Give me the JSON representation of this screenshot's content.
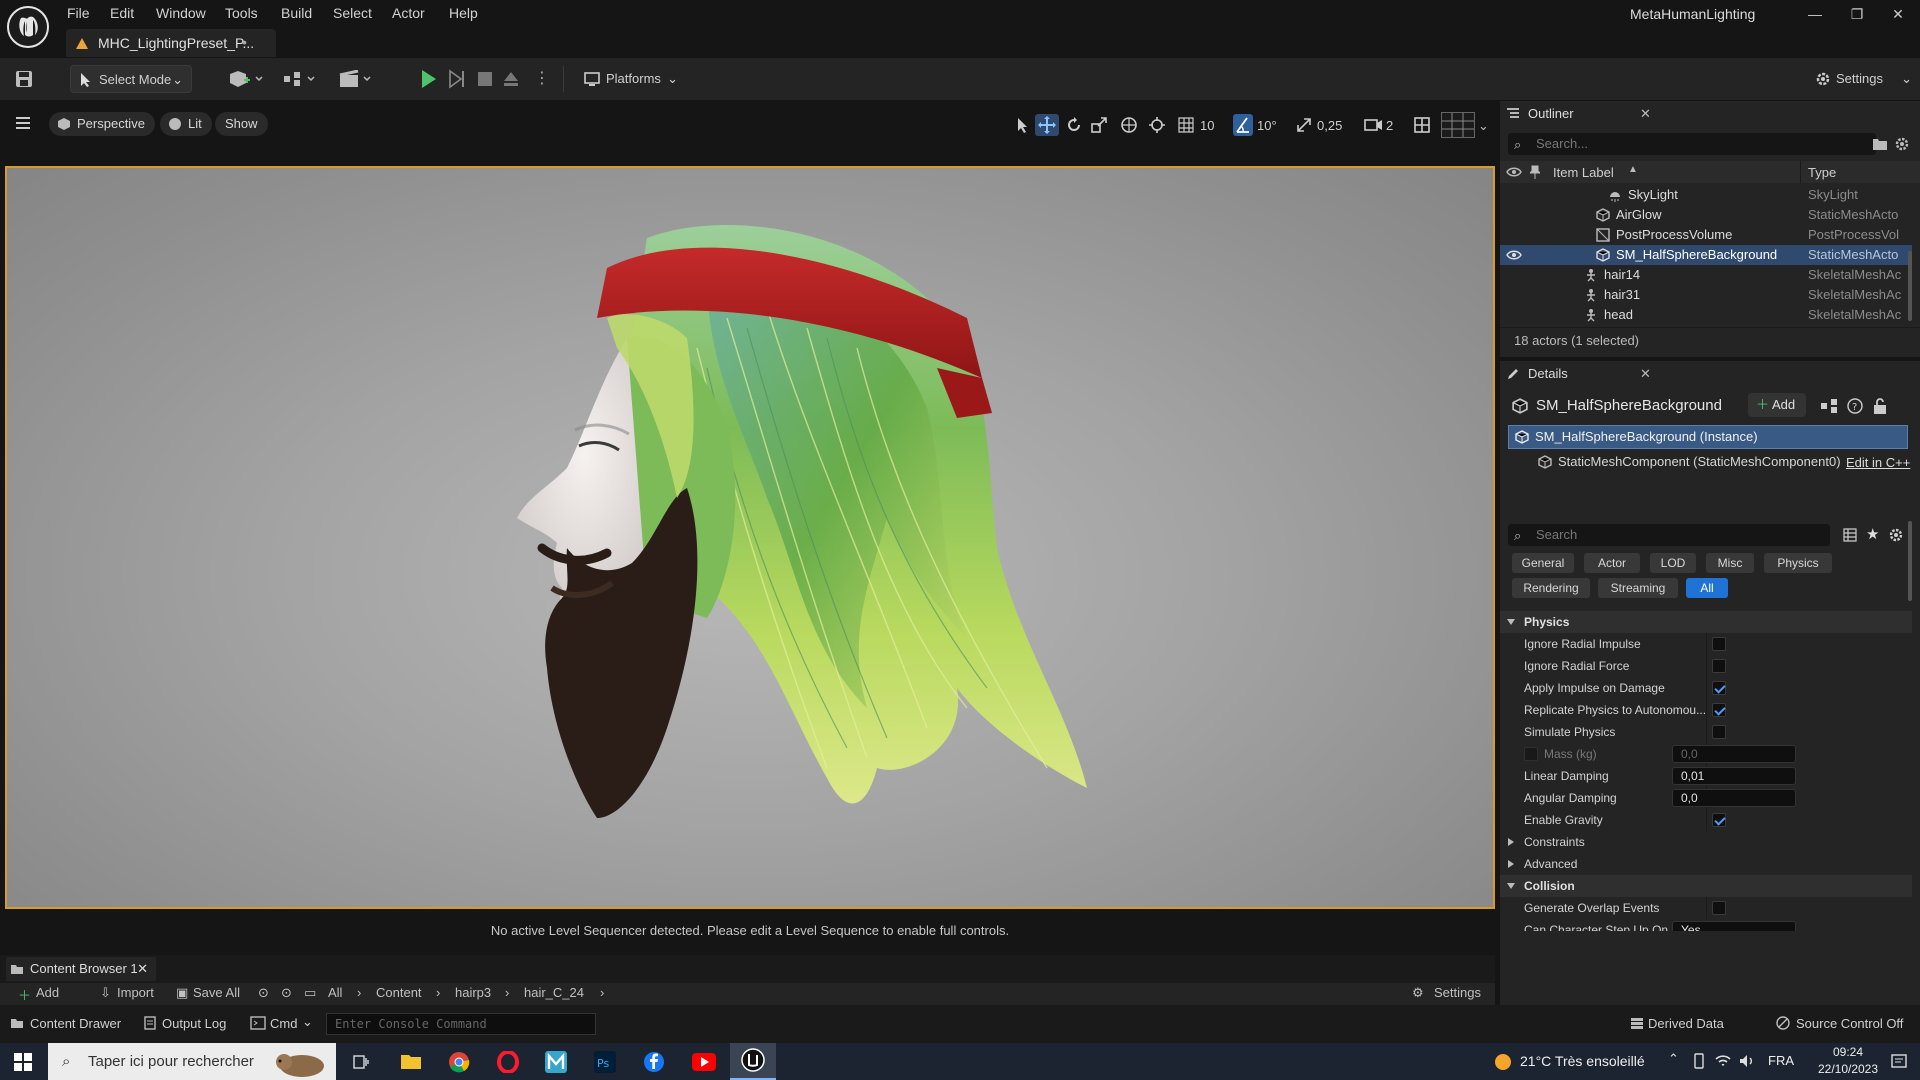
{
  "menu": [
    "File",
    "Edit",
    "Window",
    "Tools",
    "Build",
    "Select",
    "Actor",
    "Help"
  ],
  "document_tab": {
    "title": "MHC_LightingPreset_P...",
    "modified_marker": "•"
  },
  "project_name": "MetaHumanLighting",
  "toolbar": {
    "select_mode": "Select Mode",
    "platforms": "Platforms",
    "settings": "Settings"
  },
  "viewport": {
    "perspective": "Perspective",
    "lit": "Lit",
    "show": "Show",
    "grid_snap": "10",
    "rotation_snap": "10°",
    "scale_snap": "0,25",
    "camera_speed": "2",
    "message": "No active Level Sequencer detected. Please edit a Level Sequence to enable full controls."
  },
  "content_browser": {
    "tab": "Content Browser 1",
    "add": "Add",
    "import": "Import",
    "save_all": "Save All",
    "path": [
      "All",
      "Content",
      "hairp3",
      "hair_C_24"
    ],
    "settings": "Settings"
  },
  "statusbar": {
    "content_drawer": "Content Drawer",
    "output_log": "Output Log",
    "cmd": "Cmd",
    "console_placeholder": "Enter Console Command",
    "derived_data": "Derived Data",
    "source_control": "Source Control Off"
  },
  "taskbar": {
    "search_placeholder": "Taper ici pour rechercher",
    "weather": "21°C  Très ensoleillé",
    "lang": "FRA",
    "time": "09:24",
    "date": "22/10/2023"
  },
  "outliner": {
    "tab": "Outliner",
    "search_placeholder": "Search...",
    "col_label": "Item Label",
    "col_type": "Type",
    "rows": [
      {
        "label": "SkyLight",
        "type": "SkyLight"
      },
      {
        "label": "AirGlow",
        "type": "StaticMeshActo"
      },
      {
        "label": "PostProcessVolume",
        "type": "PostProcessVol"
      },
      {
        "label": "SM_HalfSphereBackground",
        "type": "StaticMeshActo"
      },
      {
        "label": "hair14",
        "type": "SkeletalMeshAc"
      },
      {
        "label": "hair31",
        "type": "SkeletalMeshAc"
      },
      {
        "label": "head",
        "type": "SkeletalMeshAc"
      }
    ],
    "count": "18 actors (1 selected)"
  },
  "details": {
    "tab": "Details",
    "title": "SM_HalfSphereBackground",
    "add": "Add",
    "instance": "SM_HalfSphereBackground (Instance)",
    "component": "StaticMeshComponent (StaticMeshComponent0)",
    "edit_cpp": "Edit in C++",
    "search_placeholder": "Search",
    "filters": [
      "General",
      "Actor",
      "LOD",
      "Misc",
      "Physics",
      "Rendering",
      "Streaming",
      "All"
    ],
    "physics_section": "Physics",
    "props": [
      {
        "label": "Ignore Radial Impulse"
      },
      {
        "label": "Ignore Radial Force"
      },
      {
        "label": "Apply Impulse on Damage"
      },
      {
        "label": "Replicate Physics to Autonomou..."
      },
      {
        "label": "Simulate Physics"
      },
      {
        "label": "Mass (kg)",
        "value": "0,0"
      },
      {
        "label": "Linear Damping",
        "value": "0,01"
      },
      {
        "label": "Angular Damping",
        "value": "0,0"
      },
      {
        "label": "Enable Gravity"
      }
    ],
    "constraints": "Constraints",
    "advanced": "Advanced",
    "collision_section": "Collision",
    "gen_overlap": "Generate Overlap Events",
    "can_step": "Can Character Step Up On",
    "can_step_value": "Yes"
  }
}
